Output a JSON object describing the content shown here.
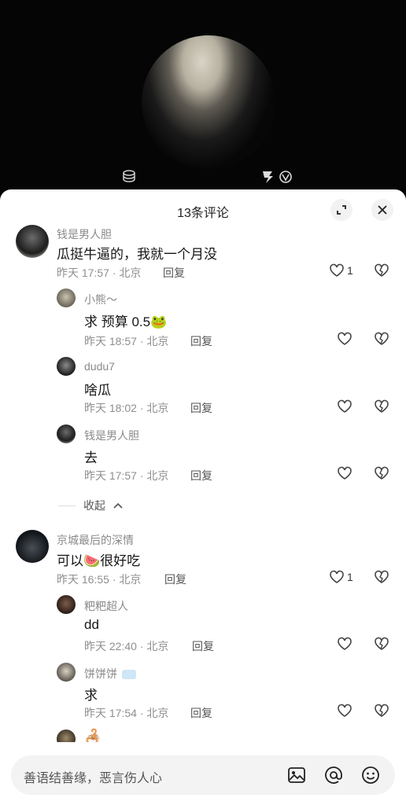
{
  "video": {
    "icons": [
      "coin-stack-icon",
      "brand-logo-icon"
    ]
  },
  "header": {
    "title": "13条评论",
    "expand_icon": "expand-icon",
    "close_icon": "close-icon"
  },
  "comments": [
    {
      "user": "钱是男人胆",
      "text": "瓜挺牛逼的，我就一个月没",
      "time": "昨天 17:57 · 北京",
      "reply": "回复",
      "likes": "1"
    },
    {
      "user": "小熊～",
      "text": "求 预算 0.5",
      "emoji": "frog-face",
      "time": "昨天 18:57 · 北京",
      "reply": "回复",
      "likes": ""
    },
    {
      "user": "dudu7",
      "text": "啥瓜",
      "time": "昨天 18:02 · 北京",
      "reply": "回复",
      "likes": ""
    },
    {
      "user": "钱是男人胆",
      "text": "去",
      "time": "昨天 17:57 · 北京",
      "reply": "回复",
      "likes": ""
    },
    {
      "user": "京城最后的深情",
      "text_a": "可以",
      "emoji": "watermelon",
      "text_b": "很好吃",
      "time": "昨天 16:55 · 北京",
      "reply": "回复",
      "likes": "1"
    },
    {
      "user": "粑粑超人",
      "text": "dd",
      "time": "昨天 22:40 · 北京",
      "reply": "回复",
      "likes": ""
    },
    {
      "user": "饼饼饼",
      "badge": "snow-badge",
      "text": "求",
      "time": "昨天 17:54 · 北京",
      "reply": "回复",
      "likes": ""
    },
    {
      "user": "",
      "emoji": "scorpion"
    }
  ],
  "collapse": {
    "label": "收起",
    "icon": "chevron-up-icon"
  },
  "input": {
    "placeholder": "善语结善缘，恶言伤人心",
    "icons": [
      "image-icon",
      "at-icon",
      "emoji-icon"
    ]
  }
}
